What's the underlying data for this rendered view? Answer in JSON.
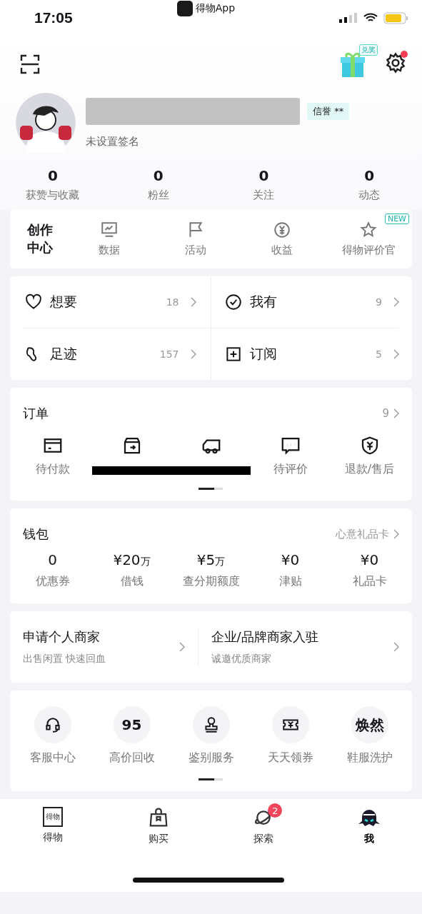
{
  "status_bar": {
    "time": "17:05",
    "app_label": "得物App"
  },
  "header": {
    "gift_badge": "兑奖",
    "settings_dot": true
  },
  "profile": {
    "credit_badge": "信誉 **",
    "signature": "未设置签名"
  },
  "stats": [
    {
      "value": "0",
      "label": "获赞与收藏"
    },
    {
      "value": "0",
      "label": "粉丝"
    },
    {
      "value": "0",
      "label": "关注"
    },
    {
      "value": "0",
      "label": "动态"
    }
  ],
  "creator_center": {
    "title_lines": [
      "创作",
      "中心"
    ],
    "items": [
      {
        "label": "数据"
      },
      {
        "label": "活动"
      },
      {
        "label": "收益"
      },
      {
        "label": "得物评价官",
        "badge": "NEW"
      }
    ]
  },
  "collections": [
    {
      "label": "想要",
      "count": "18"
    },
    {
      "label": "我有",
      "count": "9"
    },
    {
      "label": "足迹",
      "count": "157"
    },
    {
      "label": "订阅",
      "count": "5"
    }
  ],
  "orders": {
    "title": "订单",
    "count": "9",
    "items": [
      {
        "label": "待付款"
      },
      {
        "redacted": true
      },
      {
        "redacted": true
      },
      {
        "label": "待评价"
      },
      {
        "label": "退款/售后"
      }
    ]
  },
  "wallet": {
    "title": "钱包",
    "link": "心意礼品卡",
    "items": [
      {
        "value": "0",
        "label": "优惠券"
      },
      {
        "value": "¥20",
        "unit": "万",
        "label": "借钱"
      },
      {
        "value": "¥5",
        "unit": "万",
        "label": "查分期额度"
      },
      {
        "value": "¥0",
        "label": "津贴"
      },
      {
        "value": "¥0",
        "label": "礼品卡"
      }
    ]
  },
  "merchant": [
    {
      "title": "申请个人商家",
      "subtitle": "出售闲置 快速回血"
    },
    {
      "title": "企业/品牌商家入驻",
      "subtitle": "诚邀优质商家"
    }
  ],
  "services": [
    {
      "label": "客服中心"
    },
    {
      "label": "高价回收",
      "icon_text": "95"
    },
    {
      "label": "鉴别服务"
    },
    {
      "label": "天天领券"
    },
    {
      "label": "鞋服洗护",
      "icon_text": "焕然"
    }
  ],
  "tab_bar": [
    {
      "label": "得物",
      "selected": false,
      "icon_text": "得物"
    },
    {
      "label": "购买",
      "selected": false
    },
    {
      "label": "探索",
      "selected": false,
      "badge": "2"
    },
    {
      "label": "我",
      "selected": true
    }
  ]
}
